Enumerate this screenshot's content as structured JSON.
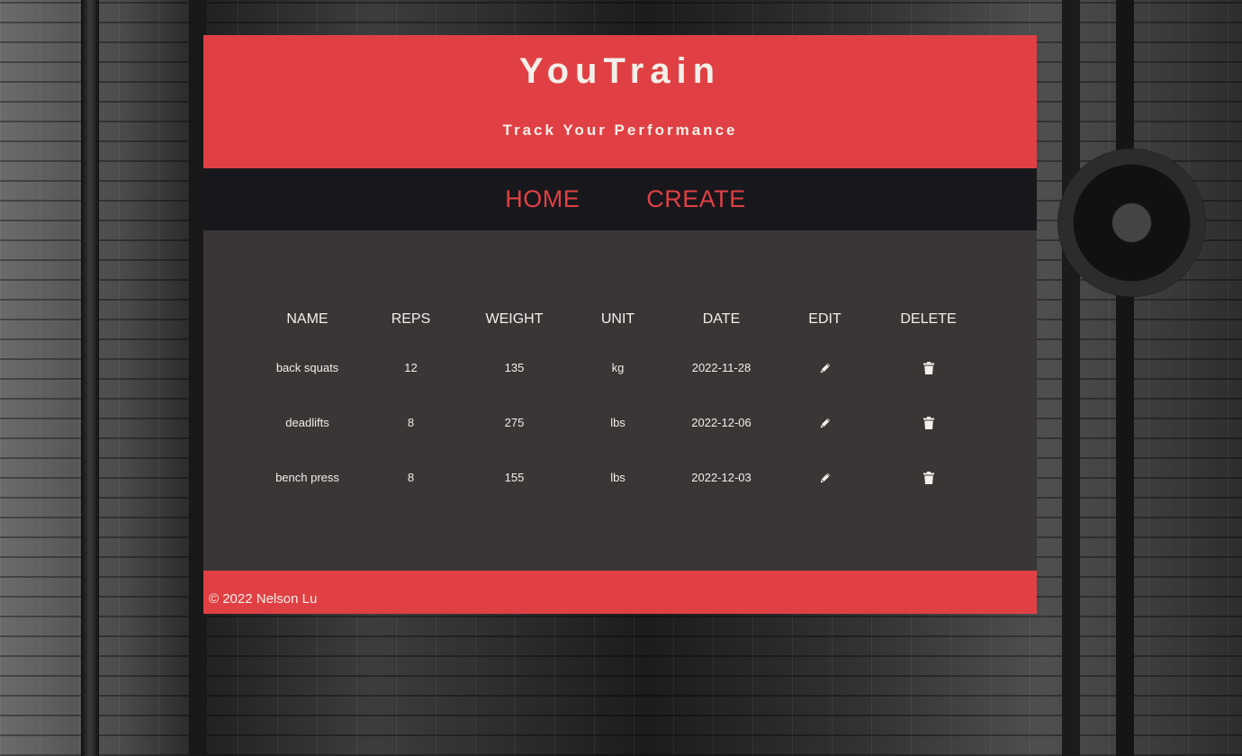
{
  "header": {
    "title": "YouTrain",
    "subtitle": "Track Your Performance"
  },
  "nav": {
    "home_label": "HOME",
    "create_label": "CREATE"
  },
  "table": {
    "columns": [
      "NAME",
      "REPS",
      "WEIGHT",
      "UNIT",
      "DATE",
      "EDIT",
      "DELETE"
    ],
    "rows": [
      {
        "name": "back squats",
        "reps": "12",
        "weight": "135",
        "unit": "kg",
        "date": "2022-11-28",
        "edit_icon": "pencil-icon",
        "delete_icon": "trash-icon"
      },
      {
        "name": "deadlifts",
        "reps": "8",
        "weight": "275",
        "unit": "lbs",
        "date": "2022-12-06",
        "edit_icon": "pencil-icon",
        "delete_icon": "trash-icon"
      },
      {
        "name": "bench press",
        "reps": "8",
        "weight": "155",
        "unit": "lbs",
        "date": "2022-12-03",
        "edit_icon": "pencil-icon",
        "delete_icon": "trash-icon"
      }
    ]
  },
  "footer": {
    "text": "© 2022 Nelson Lu"
  },
  "colors": {
    "accent": "#e04044",
    "nav_bg": "#18181c",
    "main_bg": "#3a3636",
    "text_light": "#f3efe9"
  }
}
